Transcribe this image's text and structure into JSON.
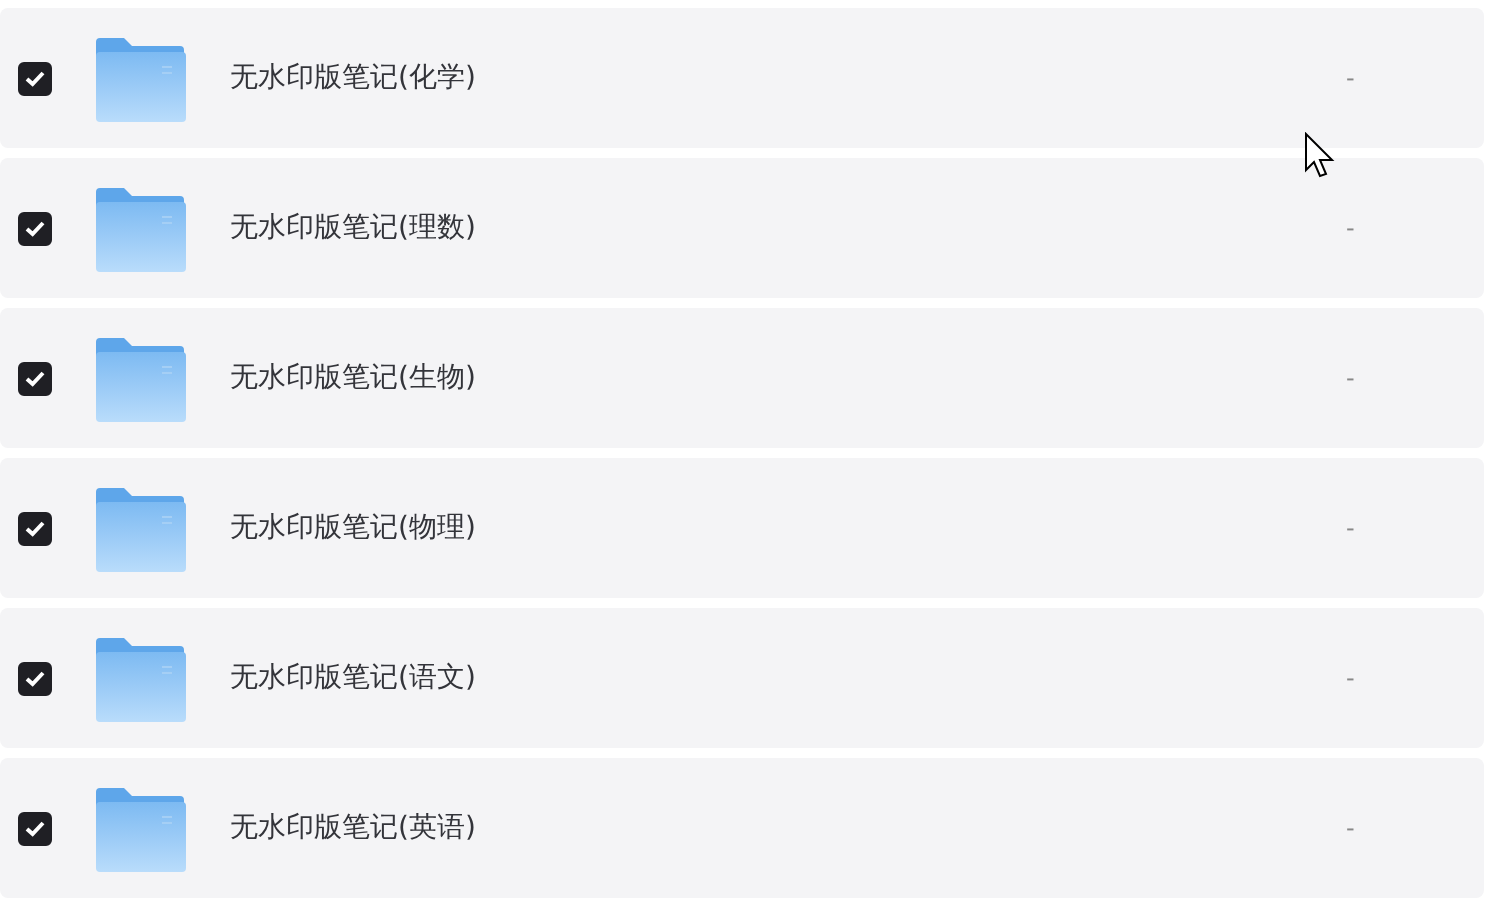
{
  "files": [
    {
      "name": "无水印版笔记(化学)",
      "checked": true,
      "size": "-"
    },
    {
      "name": "无水印版笔记(理数)",
      "checked": true,
      "size": "-"
    },
    {
      "name": "无水印版笔记(生物)",
      "checked": true,
      "size": "-"
    },
    {
      "name": "无水印版笔记(物理)",
      "checked": true,
      "size": "-"
    },
    {
      "name": "无水印版笔记(语文)",
      "checked": true,
      "size": "-"
    },
    {
      "name": "无水印版笔记(英语)",
      "checked": true,
      "size": "-"
    }
  ]
}
